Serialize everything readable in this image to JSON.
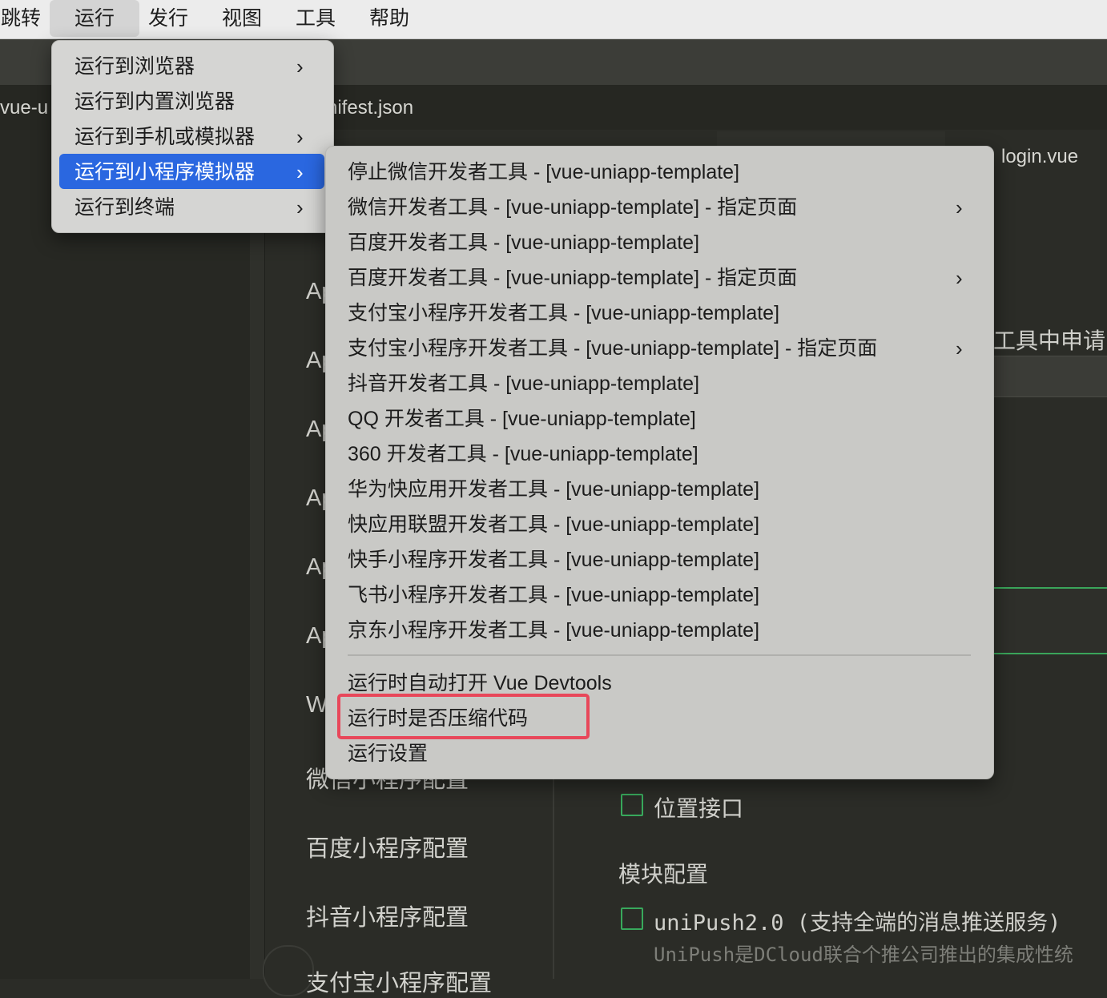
{
  "menubar": {
    "items": [
      "跳转",
      "运行",
      "发行",
      "视图",
      "工具",
      "帮助"
    ],
    "active": "运行"
  },
  "tabs": {
    "left_partial": "vue-u",
    "manifest": "nifest.json",
    "login": "login.vue"
  },
  "config_nav": {
    "partial_items": [
      "Ap",
      "Ap",
      "Ap",
      "Ap",
      "Ap",
      "Ap",
      "W"
    ],
    "items": [
      "微信小程序配置",
      "百度小程序配置",
      "抖音小程序配置",
      "支付宝小程序配置"
    ]
  },
  "right_panel": {
    "partial_text": "工具中申请",
    "location_api": "位置接口",
    "module_config": "模块配置",
    "unipush": "uniPush2.0 (支持全端的消息推送服务)",
    "unipush_desc": "UniPush是DCloud联合个推公司推出的集成性统"
  },
  "run_menu": {
    "items": [
      {
        "label": "运行到浏览器",
        "submenu": true
      },
      {
        "label": "运行到内置浏览器",
        "submenu": false
      },
      {
        "label": "运行到手机或模拟器",
        "submenu": true
      },
      {
        "label": "运行到小程序模拟器",
        "submenu": true,
        "highlighted": true
      },
      {
        "label": "运行到终端",
        "submenu": true
      }
    ]
  },
  "miniprogram_menu": {
    "items": [
      {
        "label": "停止微信开发者工具 - [vue-uniapp-template]",
        "submenu": false
      },
      {
        "label": "微信开发者工具 - [vue-uniapp-template] - 指定页面",
        "submenu": true
      },
      {
        "label": "百度开发者工具 - [vue-uniapp-template]",
        "submenu": false
      },
      {
        "label": "百度开发者工具 - [vue-uniapp-template] - 指定页面",
        "submenu": true
      },
      {
        "label": "支付宝小程序开发者工具 - [vue-uniapp-template]",
        "submenu": false
      },
      {
        "label": "支付宝小程序开发者工具 - [vue-uniapp-template] - 指定页面",
        "submenu": true
      },
      {
        "label": "抖音开发者工具 - [vue-uniapp-template]",
        "submenu": false
      },
      {
        "label": "QQ 开发者工具 - [vue-uniapp-template]",
        "submenu": false
      },
      {
        "label": "360 开发者工具 - [vue-uniapp-template]",
        "submenu": false
      },
      {
        "label": "华为快应用开发者工具 - [vue-uniapp-template]",
        "submenu": false
      },
      {
        "label": "快应用联盟开发者工具 - [vue-uniapp-template]",
        "submenu": false
      },
      {
        "label": "快手小程序开发者工具 - [vue-uniapp-template]",
        "submenu": false
      },
      {
        "label": "飞书小程序开发者工具 - [vue-uniapp-template]",
        "submenu": false
      },
      {
        "label": "京东小程序开发者工具 - [vue-uniapp-template]",
        "submenu": false
      }
    ],
    "options": [
      {
        "label": "运行时自动打开 Vue Devtools"
      },
      {
        "label": "运行时是否压缩代码",
        "annotated": true
      },
      {
        "label": "运行设置"
      }
    ]
  },
  "colors": {
    "highlight": "#2a67e0",
    "annotation": "#e8475a",
    "checkbox": "#38a95c"
  }
}
